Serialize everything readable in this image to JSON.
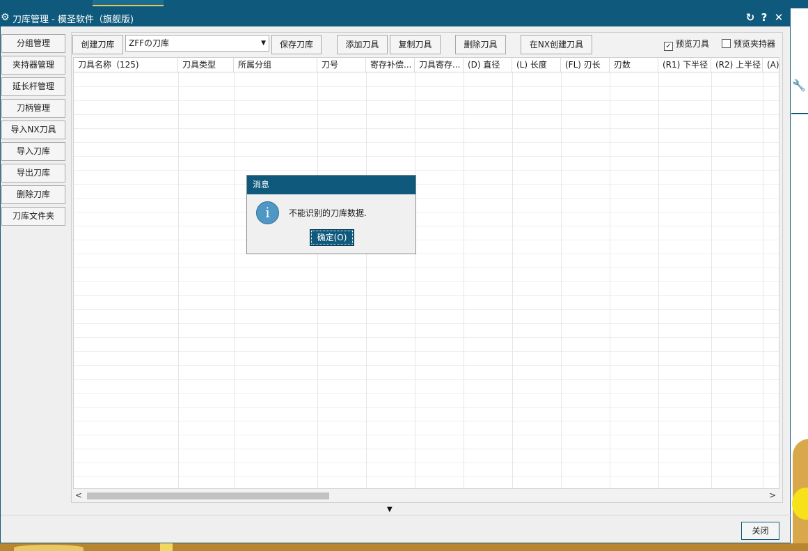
{
  "window": {
    "title": "刀库管理 - 模圣软件（旗舰版)",
    "close_label": "关闭"
  },
  "sidebar": {
    "items": [
      {
        "label": "分组管理"
      },
      {
        "label": "夹持器管理"
      },
      {
        "label": "延长杆管理"
      },
      {
        "label": "刀柄管理"
      },
      {
        "label": "导入NX刀具"
      },
      {
        "label": "导入刀库"
      },
      {
        "label": "导出刀库"
      },
      {
        "label": "删除刀库"
      },
      {
        "label": "刀库文件夹"
      }
    ]
  },
  "toolbar": {
    "create_library": "创建刀库",
    "selected_library": "ZFFの刀库",
    "save_library": "保存刀库",
    "add_tool": "添加刀具",
    "copy_tool": "复制刀具",
    "delete_tool": "删除刀具",
    "create_in_nx": "在NX创建刀具",
    "preview_tool": {
      "label": "预览刀具",
      "checked": true
    },
    "preview_holder": {
      "label": "预览夹持器",
      "checked": false
    }
  },
  "table": {
    "columns": [
      "刀具名称（125)",
      "刀具类型",
      "所属分组",
      "刀号",
      "寄存补偿...",
      "刀具寄存...",
      "(D) 直径",
      "(L) 长度",
      "(FL) 刃长",
      "刃数",
      "(R1) 下半径",
      "(R2) 上半径",
      "(A)"
    ],
    "rows": []
  },
  "message": {
    "title": "消息",
    "text": "不能识别的刀库数据.",
    "ok_label": "确定(O)"
  }
}
